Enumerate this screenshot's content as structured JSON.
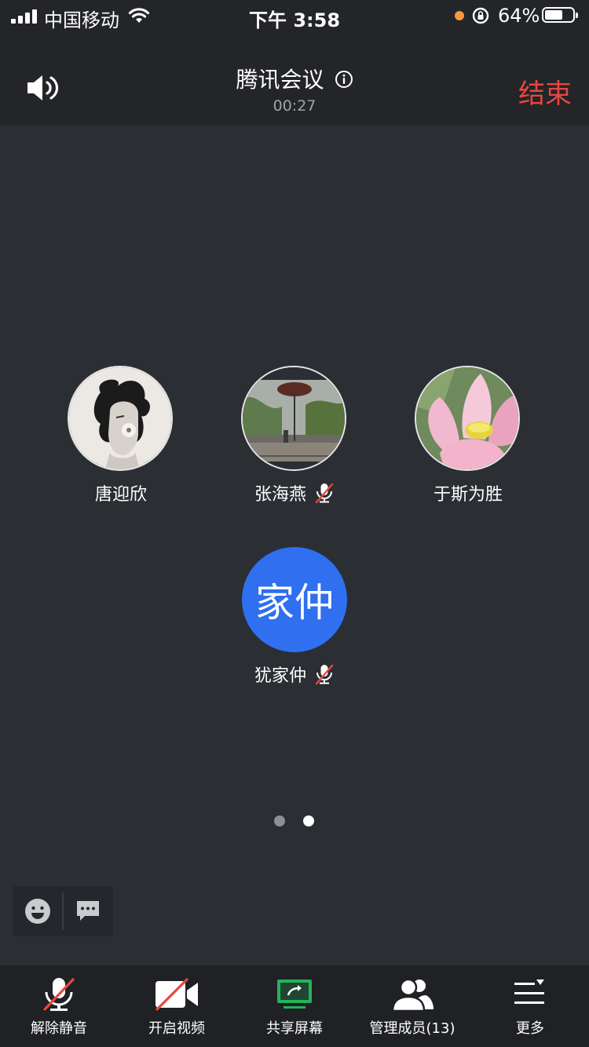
{
  "status_bar": {
    "carrier": "中国移动",
    "time": "下午 3:58",
    "battery_percent": "64%",
    "battery_level": 0.64,
    "orange_indicator_color": "#f5993a",
    "icons": [
      "signal-icon",
      "wifi-icon",
      "orientation-lock-icon",
      "battery-icon"
    ]
  },
  "header": {
    "title": "腾讯会议",
    "timer": "00:27",
    "end_label": "结束",
    "end_color": "#e8473f"
  },
  "participants": [
    {
      "name": "唐迎欣",
      "avatar": "photo-portrait",
      "muted": false
    },
    {
      "name": "张海燕",
      "avatar": "photo-landscape",
      "muted": true
    },
    {
      "name": "于斯为胜",
      "avatar": "photo-lotus",
      "muted": false
    },
    {
      "name": "犹家仲",
      "avatar_text": "家仲",
      "avatar_color": "#2f6ff0",
      "muted": true
    }
  ],
  "pager": {
    "pages": 2,
    "current": 2
  },
  "toolbar": {
    "unmute": "解除静音",
    "start_video": "开启视频",
    "share_screen": "共享屏幕",
    "manage_members": "管理成员(13)",
    "more": "更多"
  },
  "colors": {
    "background": "#2b2e33",
    "header_background": "#232529",
    "toolbar_background": "#1f2125",
    "share_green": "#23b35a",
    "muted_slash": "#e8473f"
  }
}
